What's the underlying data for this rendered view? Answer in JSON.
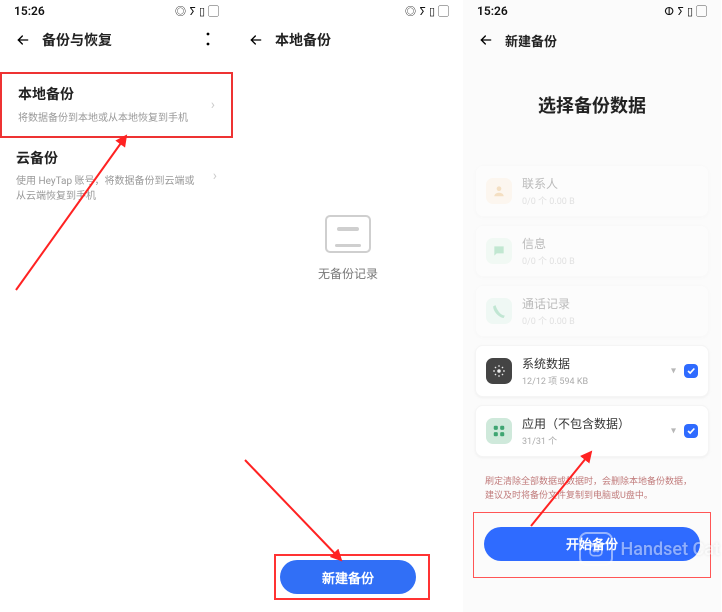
{
  "status": {
    "time": "15:26"
  },
  "screen1": {
    "title": "备份与恢复",
    "local": {
      "title": "本地备份",
      "sub": "将数据备份到本地或从本地恢复到手机"
    },
    "cloud": {
      "title": "云备份",
      "sub": "使用 HeyTap 账号，将数据备份到云端或从云端恢复到手机"
    }
  },
  "screen2": {
    "title": "本地备份",
    "empty": "无备份记录",
    "button": "新建备份"
  },
  "screen3": {
    "title": "新建备份",
    "heading": "选择备份数据",
    "items": [
      {
        "id": "contacts",
        "name": "联系人",
        "sub": "0/0 个  0.00 B"
      },
      {
        "id": "sms",
        "name": "信息",
        "sub": "0/0 个  0.00 B"
      },
      {
        "id": "calls",
        "name": "通话记录",
        "sub": "0/0 个  0.00 B"
      },
      {
        "id": "system",
        "name": "系统数据",
        "sub": "12/12 项  594 KB"
      },
      {
        "id": "apps",
        "name": "应用（不包含数据）",
        "sub": "31/31 个"
      }
    ],
    "note": "刷定清除全部数据或数据时，会删除本地备份数据，建议及时将备份文件复制到电脑或U盘中。",
    "start": "开始备份"
  },
  "watermark": "Handset Cat"
}
